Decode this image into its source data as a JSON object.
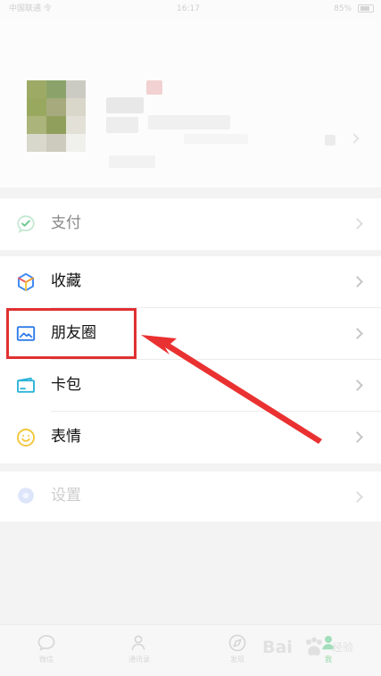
{
  "status_bar": {
    "left": "中国联通 令",
    "center": "16:17",
    "right": "85%"
  },
  "menu": {
    "payment": {
      "label": "支付",
      "icon": "wechat-pay-icon"
    },
    "favorites": {
      "label": "收藏",
      "icon": "favorites-cube-icon"
    },
    "moments": {
      "label": "朋友圈",
      "icon": "moments-picture-icon"
    },
    "card_wallet": {
      "label": "卡包",
      "icon": "card-wallet-icon"
    },
    "stickers": {
      "label": "表情",
      "icon": "smile-icon"
    },
    "settings": {
      "label": "设置",
      "icon": "settings-icon"
    }
  },
  "bottom_nav": [
    {
      "label": "微信",
      "icon": "chat-icon"
    },
    {
      "label": "通讯录",
      "icon": "contacts-icon"
    },
    {
      "label": "发现",
      "icon": "discover-icon"
    },
    {
      "label": "我",
      "icon": "me-icon"
    }
  ],
  "watermark": {
    "text": "Bai",
    "sub": "经验"
  },
  "colors": {
    "highlight": "#e03131",
    "payment_green": "#29b865",
    "favorites_orange": "#f29b28",
    "favorites_blue": "#3c86f5",
    "moments_blue": "#2f7be8",
    "card_cyan": "#2bb4d7",
    "smile_yellow": "#f2c73b",
    "settings_blue": "#8ea8f6"
  }
}
